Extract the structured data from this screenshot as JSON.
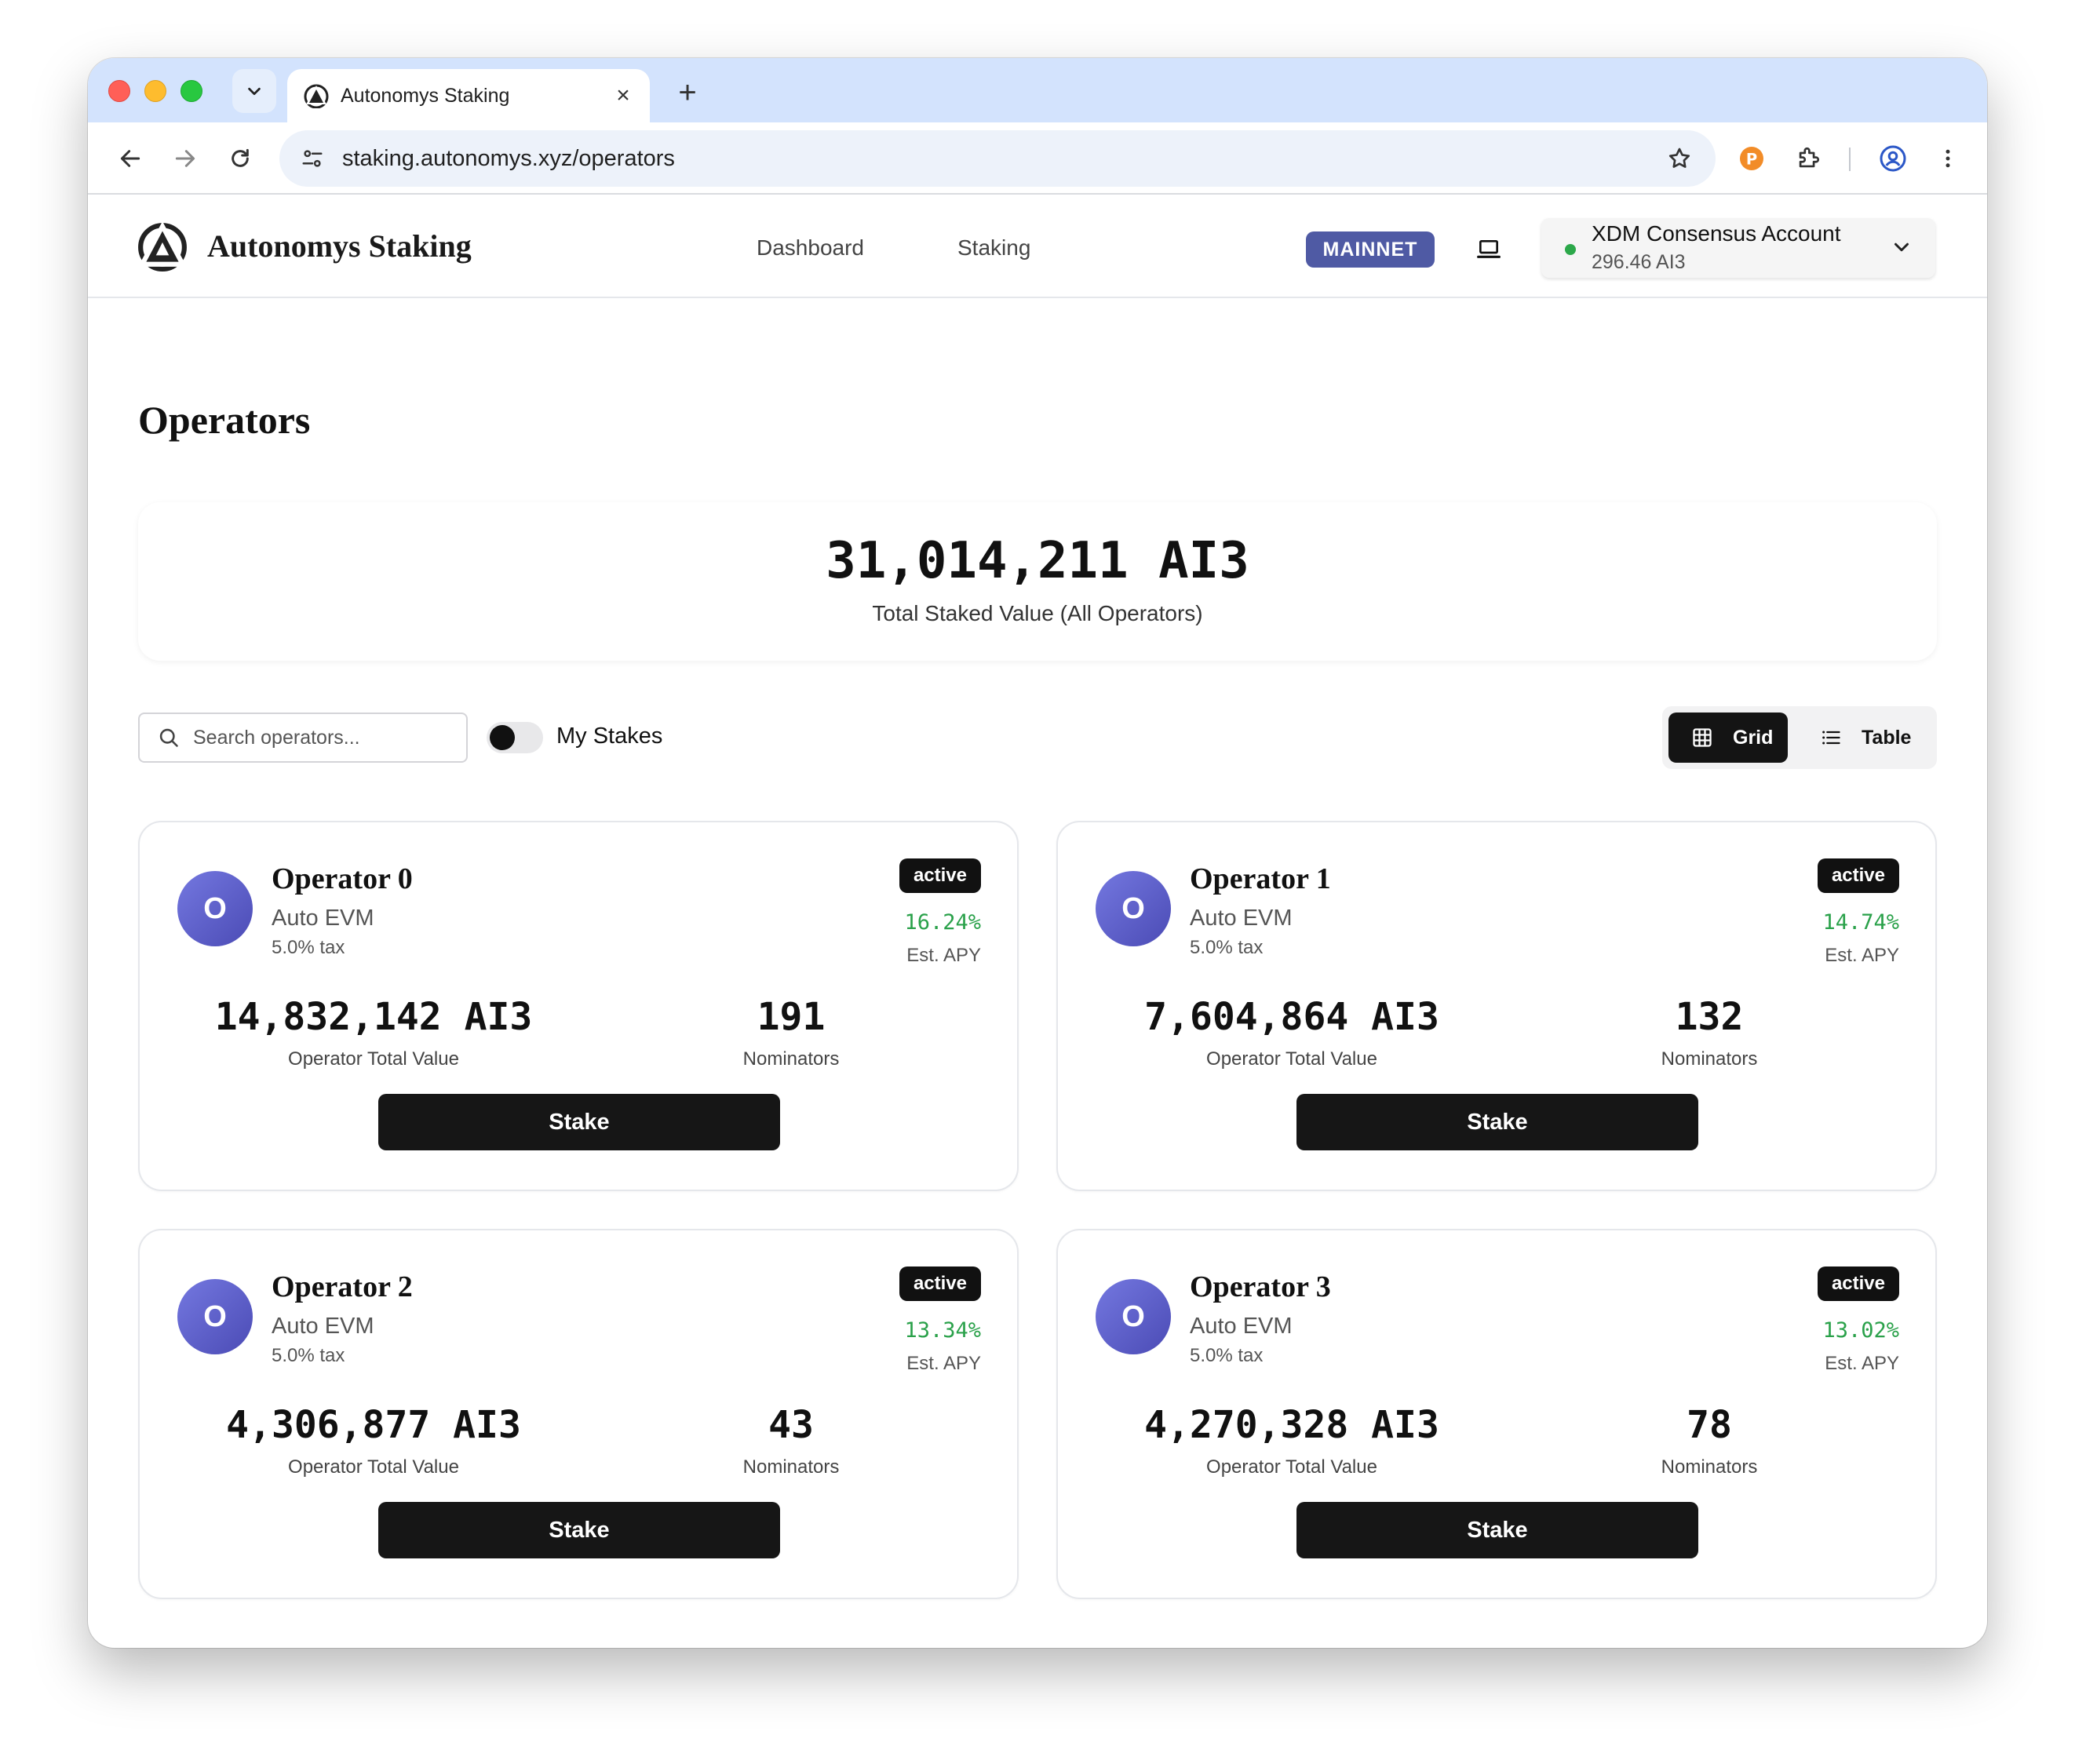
{
  "browser": {
    "tab_title": "Autonomys Staking",
    "url": "staking.autonomys.xyz/operators"
  },
  "header": {
    "brand": "Autonomys Staking",
    "nav": [
      "Dashboard",
      "Staking"
    ],
    "network_badge": "MAINNET",
    "account_name": "XDM Consensus Account",
    "account_balance": "296.46 AI3"
  },
  "page": {
    "title": "Operators",
    "total_staked": "31,014,211 AI3",
    "total_staked_label": "Total Staked Value (All Operators)"
  },
  "controls": {
    "search_placeholder": "Search operators...",
    "my_stakes_label": "My Stakes",
    "my_stakes_on": false,
    "view_grid_label": "Grid",
    "view_table_label": "Table",
    "active_view": "Grid"
  },
  "operators": [
    {
      "avatar": "O",
      "name": "Operator 0",
      "domain": "Auto EVM",
      "tax": "5.0% tax",
      "status": "active",
      "apy": "16.24%",
      "apy_label": "Est. APY",
      "total_value": "14,832,142 AI3",
      "total_value_label": "Operator Total Value",
      "nominators": "191",
      "nominators_label": "Nominators",
      "stake_label": "Stake"
    },
    {
      "avatar": "O",
      "name": "Operator 1",
      "domain": "Auto EVM",
      "tax": "5.0% tax",
      "status": "active",
      "apy": "14.74%",
      "apy_label": "Est. APY",
      "total_value": "7,604,864 AI3",
      "total_value_label": "Operator Total Value",
      "nominators": "132",
      "nominators_label": "Nominators",
      "stake_label": "Stake"
    },
    {
      "avatar": "O",
      "name": "Operator 2",
      "domain": "Auto EVM",
      "tax": "5.0% tax",
      "status": "active",
      "apy": "13.34%",
      "apy_label": "Est. APY",
      "total_value": "4,306,877 AI3",
      "total_value_label": "Operator Total Value",
      "nominators": "43",
      "nominators_label": "Nominators",
      "stake_label": "Stake"
    },
    {
      "avatar": "O",
      "name": "Operator 3",
      "domain": "Auto EVM",
      "tax": "5.0% tax",
      "status": "active",
      "apy": "13.02%",
      "apy_label": "Est. APY",
      "total_value": "4,270,328 AI3",
      "total_value_label": "Operator Total Value",
      "nominators": "78",
      "nominators_label": "Nominators",
      "stake_label": "Stake"
    }
  ],
  "colors": {
    "network_badge_bg": "#4f5aa4",
    "apy_green": "#2aa14a",
    "avatar_gradient": [
      "#7478e0",
      "#4b4bb5"
    ],
    "button_dark": "#161616"
  },
  "icons": [
    "tab-search-chevron-icon",
    "autonomys-logo-icon",
    "close-icon",
    "plus-icon",
    "back-arrow-icon",
    "forward-arrow-icon",
    "reload-icon",
    "site-settings-icon",
    "star-icon",
    "extension-icon",
    "puzzle-icon",
    "profile-icon",
    "more-vert-icon",
    "laptop-icon",
    "chevron-down-icon",
    "search-icon",
    "grid-icon",
    "list-icon"
  ]
}
